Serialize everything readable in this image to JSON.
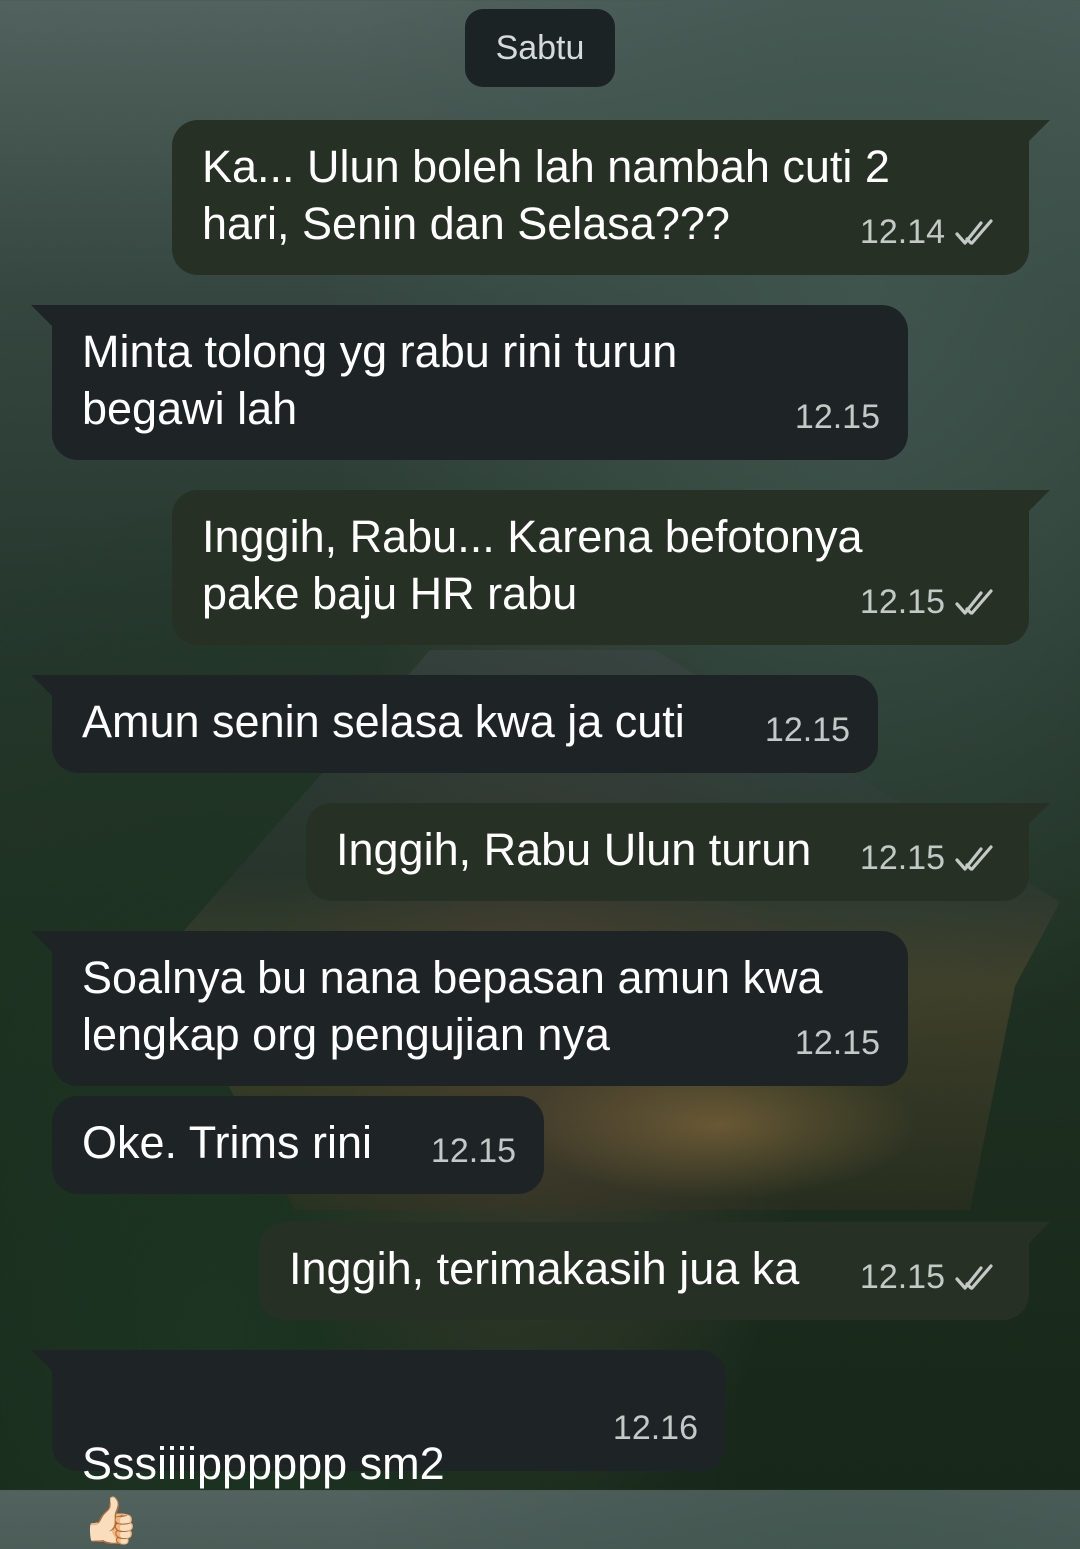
{
  "chat": {
    "date_label": "Sabtu",
    "messages": [
      {
        "text": "Ka... Ulun boleh lah nambah cuti 2\nhari, Senin dan Selasa???",
        "time": "12.14",
        "direction": "outgoing",
        "status": "read"
      },
      {
        "text": "Minta tolong yg rabu rini turun\nbegawi lah",
        "time": "12.15",
        "direction": "incoming"
      },
      {
        "text": "Inggih, Rabu... Karena befotonya\npake baju HR rabu",
        "time": "12.15",
        "direction": "outgoing",
        "status": "read"
      },
      {
        "text": "Amun senin selasa kwa ja cuti",
        "time": "12.15",
        "direction": "incoming"
      },
      {
        "text": "Inggih, Rabu Ulun turun",
        "time": "12.15",
        "direction": "outgoing",
        "status": "read"
      },
      {
        "text": "Soalnya bu nana bepasan amun kwa\nlengkap org pengujian nya",
        "time": "12.15",
        "direction": "incoming"
      },
      {
        "text": "Oke. Trims rini",
        "time": "12.15",
        "direction": "incoming"
      },
      {
        "text": "Inggih, terimakasih jua ka",
        "time": "12.15",
        "direction": "outgoing",
        "status": "read"
      },
      {
        "text": "Sssiiiipppppp  sm2",
        "emoji": "👍🏻",
        "time": "12.16",
        "direction": "incoming"
      }
    ]
  },
  "colors": {
    "outgoing_bubble": "#263024",
    "incoming_bubble": "#1e2426",
    "read_check": "#c4c9c6"
  },
  "icons": {
    "read_receipt": "double-check-icon"
  }
}
